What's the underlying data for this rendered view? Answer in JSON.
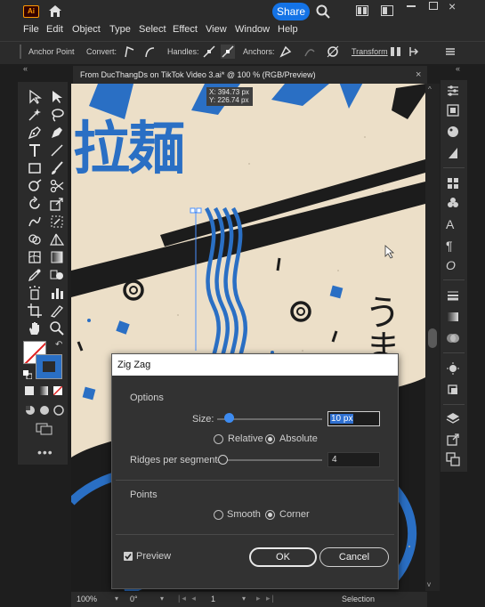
{
  "app": {
    "logo_text": "Ai",
    "share_label": "Share",
    "menu": [
      "File",
      "Edit",
      "Object",
      "Type",
      "Select",
      "Effect",
      "View",
      "Window",
      "Help"
    ]
  },
  "control_bar": {
    "anchor_point": "Anchor Point",
    "convert": "Convert:",
    "handles": "Handles:",
    "anchors": "Anchors:",
    "transform": "Transform"
  },
  "document": {
    "tab_title": "From DucThangDs on TikTok Video 3.ai* @ 100 % (RGB/Preview)",
    "tab_close": "×"
  },
  "canvas": {
    "kanji_left": "拉麺",
    "kana_right": "うま",
    "coord_x": "X: 394.73 px",
    "coord_y": "Y: 226.74 px"
  },
  "dialog": {
    "title": "Zig Zag",
    "options_heading": "Options",
    "size_label": "Size:",
    "size_value": "10 px",
    "size_slider_fraction": 0.14,
    "relative_label": "Relative",
    "absolute_label": "Absolute",
    "mode_selected": "Absolute",
    "ridges_label": "Ridges per segment:",
    "ridges_value": "4",
    "ridges_slider_fraction": 0.0,
    "points_heading": "Points",
    "smooth_label": "Smooth",
    "corner_label": "Corner",
    "points_selected": "Corner",
    "preview_label": "Preview",
    "preview_checked": true,
    "ok_label": "OK",
    "cancel_label": "Cancel"
  },
  "status_bar": {
    "zoom": "100%",
    "rotation": "0°",
    "artboard": "1",
    "tool": "Selection"
  },
  "colors": {
    "accent": "#1473e6",
    "art_blue": "#2a6fc4",
    "paper": "#ecdfc8",
    "ink": "#1c1c1c"
  }
}
